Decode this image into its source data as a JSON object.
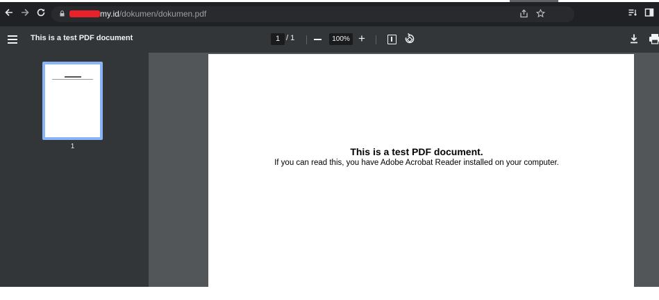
{
  "browser": {
    "url_host": "my.id",
    "url_path": "/dokumen/dokumen.pdf",
    "back_icon": "arrow-left-icon",
    "forward_icon": "arrow-right-icon",
    "reload_icon": "reload-icon",
    "share_icon": "share-icon",
    "bookmark_icon": "star-icon",
    "reading_list_icon": "reading-list-icon",
    "side_panel_icon": "side-panel-icon"
  },
  "pdf_toolbar": {
    "title": "This is a test PDF document",
    "current_page": "1",
    "page_separator": "/ 1",
    "zoom": "100%",
    "zoom_plus": "+",
    "menu_icon": "hamburger-menu-icon",
    "fit_icon": "fit-to-page-icon",
    "rotate_icon": "rotate-icon",
    "download_icon": "download-icon",
    "print_icon": "print-icon"
  },
  "sidebar": {
    "thumbnails": [
      {
        "label": "1",
        "selected": true
      }
    ]
  },
  "document": {
    "heading": "This is a test PDF document.",
    "body": "If you can read this, you have Adobe Acrobat Reader installed on your computer."
  },
  "colors": {
    "browser_bar": "#202124",
    "pdf_toolbar": "#323639",
    "viewer_background": "#525659",
    "thumbnail_highlight": "#8ab4f8",
    "redaction": "#e8212a"
  }
}
